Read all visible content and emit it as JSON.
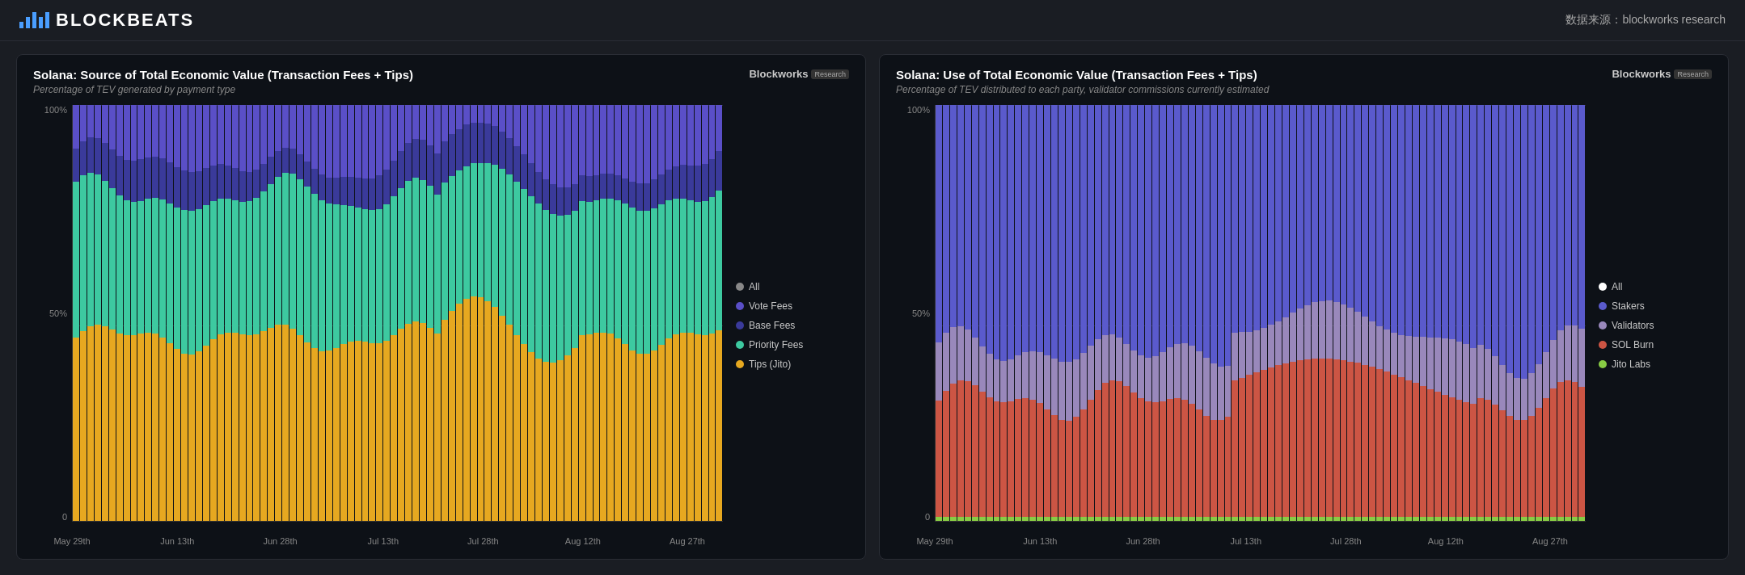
{
  "header": {
    "logo_text": "BLOCKBEATS",
    "data_source": "数据来源：blockworks research"
  },
  "charts": [
    {
      "id": "source-chart",
      "title": "Solana: Source of Total Economic Value (Transaction Fees + Tips)",
      "subtitle": "Percentage of TEV generated by payment type",
      "brand": "Blockworks",
      "brand_badge": "Research",
      "y_labels": [
        "100%",
        "50%",
        "0"
      ],
      "x_labels": [
        "May 29th",
        "Jun 13th",
        "Jun 28th",
        "Jul 13th",
        "Jul 28th",
        "Aug 12th",
        "Aug 27th"
      ],
      "legend": [
        {
          "label": "All",
          "color": "#888888"
        },
        {
          "label": "Vote Fees",
          "color": "#5555cc"
        },
        {
          "label": "Base Fees",
          "color": "#4444aa"
        },
        {
          "label": "Priority Fees",
          "color": "#44ccaa"
        },
        {
          "label": "Tips (Jito)",
          "color": "#ddaa22"
        }
      ],
      "colors": {
        "vote_fees": "#5a4fc7",
        "base_fees": "#3a3a8a",
        "priority_fees": "#3dc9a0",
        "tips": "#e6a820"
      }
    },
    {
      "id": "use-chart",
      "title": "Solana: Use of Total Economic Value (Transaction Fees + Tips)",
      "subtitle": "Percentage of TEV distributed to each party, validator commissions currently estimated",
      "brand": "Blockworks",
      "brand_badge": "Research",
      "y_labels": [
        "100%",
        "50%",
        "0"
      ],
      "x_labels": [
        "May 29th",
        "Jun 13th",
        "Jun 28th",
        "Jul 13th",
        "Jul 28th",
        "Aug 12th",
        "Aug 27th"
      ],
      "legend": [
        {
          "label": "All",
          "color": "#ffffff"
        },
        {
          "label": "Stakers",
          "color": "#6666cc"
        },
        {
          "label": "Validators",
          "color": "#9988cc"
        },
        {
          "label": "SOL Burn",
          "color": "#cc5544"
        },
        {
          "label": "Jito Labs",
          "color": "#88cc44"
        }
      ],
      "colors": {
        "stakers": "#5a5acc",
        "validators": "#9988bb",
        "sol_burn": "#cc5544",
        "jito_labs": "#88cc44"
      }
    }
  ]
}
